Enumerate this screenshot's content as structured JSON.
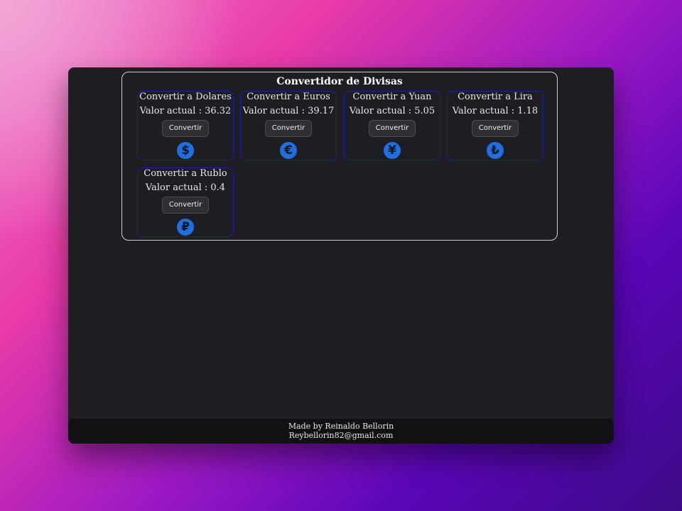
{
  "app": {
    "title": "Convertidor de Divisas"
  },
  "cards": [
    {
      "title": "Convertir a Dolares",
      "value_label": "Valor actual : 36.32",
      "button_label": "Convertir",
      "icon": "dollar-icon",
      "glyph": "$"
    },
    {
      "title": "Convertir a Euros",
      "value_label": "Valor actual : 39.17",
      "button_label": "Convertir",
      "icon": "euro-icon",
      "glyph": "€"
    },
    {
      "title": "Convertir a Yuan",
      "value_label": "Valor actual : 5.05",
      "button_label": "Convertir",
      "icon": "yuan-icon",
      "glyph": "¥"
    },
    {
      "title": "Convertir a Lira",
      "value_label": "Valor actual : 1.18",
      "button_label": "Convertir",
      "icon": "lira-icon",
      "glyph": "₺"
    },
    {
      "title": "Convertir a Rublo",
      "value_label": "Valor actual : 0.4",
      "button_label": "Convertir",
      "icon": "ruble-icon",
      "glyph": "₽"
    }
  ],
  "footer": {
    "line1": "Made by Reinaldo Bellorin",
    "line2": "Reybellorin82@gmail.com"
  },
  "colors": {
    "card_border": "#1c1ea8",
    "icon_fill": "#1f6fe0",
    "window_bg": "#1e1e22"
  }
}
